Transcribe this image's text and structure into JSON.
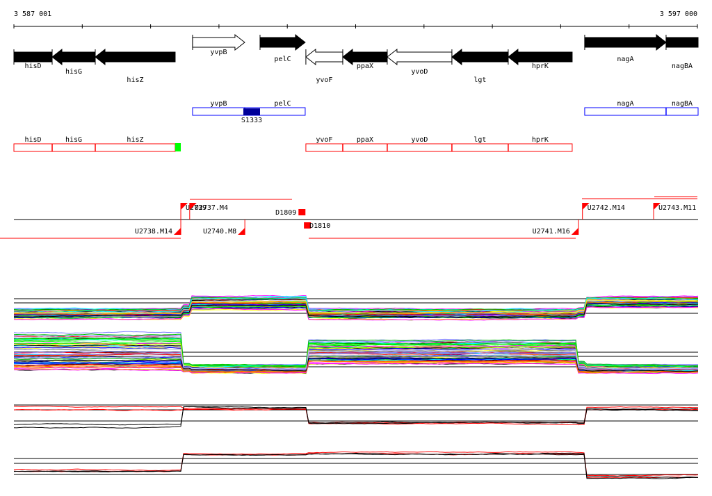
{
  "ruler": {
    "start_label": "3 587 001",
    "end_label": "3 597 000",
    "start": 3587001,
    "end": 3597000
  },
  "genes": [
    {
      "name": "hisD",
      "start": 3587001,
      "end": 3587560,
      "strand": "-",
      "fill": "black"
    },
    {
      "name": "hisG",
      "start": 3587560,
      "end": 3588190,
      "strand": "-",
      "fill": "black"
    },
    {
      "name": "hisZ",
      "start": 3588190,
      "end": 3589358,
      "strand": "-",
      "fill": "black"
    },
    {
      "name": "yvpB",
      "start": 3589612,
      "end": 3590374,
      "strand": "+",
      "fill": "white"
    },
    {
      "name": "pelC",
      "start": 3590598,
      "end": 3591258,
      "strand": "+",
      "fill": "black"
    },
    {
      "name": "yvoF",
      "start": 3591268,
      "end": 3591807,
      "strand": "-",
      "fill": "white"
    },
    {
      "name": "ppaX",
      "start": 3591807,
      "end": 3592457,
      "strand": "-",
      "fill": "black"
    },
    {
      "name": "yvoD",
      "start": 3592457,
      "end": 3593402,
      "strand": "-",
      "fill": "white"
    },
    {
      "name": "lgt",
      "start": 3593402,
      "end": 3594225,
      "strand": "-",
      "fill": "black"
    },
    {
      "name": "hprK",
      "start": 3594225,
      "end": 3595160,
      "strand": "-",
      "fill": "black"
    },
    {
      "name": "nagA",
      "start": 3595343,
      "end": 3596532,
      "strand": "+",
      "fill": "black"
    },
    {
      "name": "nagBA",
      "start": 3596532,
      "end": 3597000,
      "strand": "+",
      "fill": "black"
    }
  ],
  "operons_plus": [
    {
      "genes": [
        "yvpB",
        "pelC"
      ],
      "start": 3589612,
      "end": 3591258
    },
    {
      "genes": [
        "nagA",
        "nagBA"
      ],
      "start": 3595343,
      "end": 3597000
    }
  ],
  "operons_plus_boundaries": [
    3590374,
    3596532
  ],
  "site": {
    "name": "S1333",
    "start": 3590354,
    "end": 3590598,
    "color": "#000099"
  },
  "operons_minus": [
    {
      "genes": [
        "hisD",
        "hisG",
        "hisZ"
      ],
      "start": 3587001,
      "end": 3589358
    },
    {
      "genes": [
        "yvoF",
        "ppaX",
        "yvoD",
        "lgt",
        "hprK"
      ],
      "start": 3591268,
      "end": 3595160
    }
  ],
  "operons_minus_boundaries": [
    3587560,
    3588190,
    3591807,
    3592457,
    3593402,
    3594225
  ],
  "terminator_block": {
    "start": 3589358,
    "end": 3589440,
    "color": "#00ff00"
  },
  "transcription": {
    "upper": [
      {
        "label": "U2739",
        "pos": 3589440
      },
      {
        "label": "U2737.M4",
        "pos": 3589570
      },
      {
        "label": "U2742.M14",
        "pos": 3595310
      },
      {
        "label": "U2743.M11",
        "pos": 3596350
      }
    ],
    "lower": [
      {
        "label": "U2738.M14",
        "pos": 3589440
      },
      {
        "label": "U2740.M8",
        "pos": 3590376
      },
      {
        "label": "U2741.M16",
        "pos": 3595250
      }
    ],
    "down_upper": {
      "label": "D1809",
      "pos": 3591170
    },
    "down_lower": {
      "label": "D1810",
      "pos": 3591260
    }
  },
  "colors": {
    "accent": "#ff0000",
    "operon_plus": "#0000ff",
    "operon_minus": "#ff0000"
  }
}
